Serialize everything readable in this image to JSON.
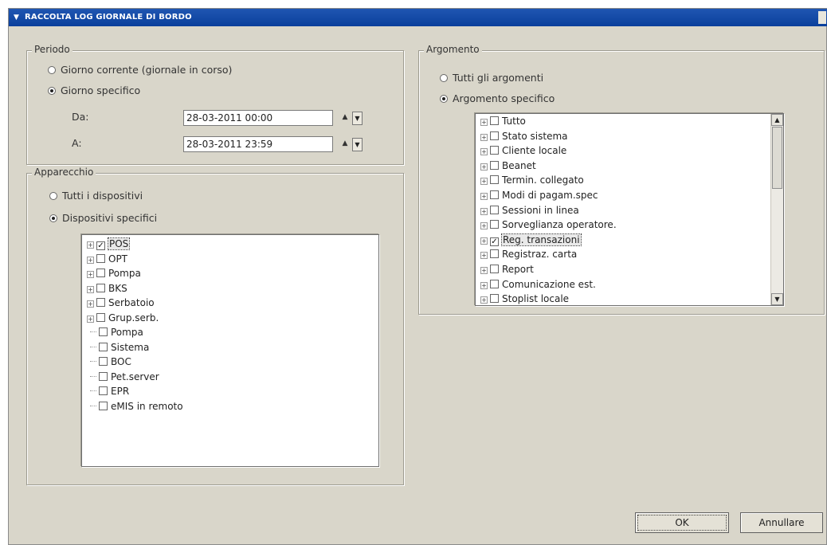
{
  "window": {
    "title": "RACCOLTA LOG GIORNALE DI BORDO"
  },
  "periodo": {
    "legend": "Periodo",
    "radio_current": "Giorno corrente (giornale in corso)",
    "radio_specific": "Giorno specifico",
    "da_label": "Da:",
    "da_value": "28-03-2011 00:00",
    "a_label": "A:",
    "a_value": "28-03-2011 23:59"
  },
  "apparecchio": {
    "legend": "Apparecchio",
    "radio_all": "Tutti i dispositivi",
    "radio_specific": "Dispositivi specifici",
    "devices": [
      {
        "label": "POS",
        "checked": true,
        "expandable": true
      },
      {
        "label": "OPT",
        "checked": false,
        "expandable": true
      },
      {
        "label": "Pompa",
        "checked": false,
        "expandable": true
      },
      {
        "label": "BKS",
        "checked": false,
        "expandable": true
      },
      {
        "label": "Serbatoio",
        "checked": false,
        "expandable": true
      },
      {
        "label": "Grup.serb.",
        "checked": false,
        "expandable": true
      },
      {
        "label": "Pompa",
        "checked": false,
        "expandable": false
      },
      {
        "label": "Sistema",
        "checked": false,
        "expandable": false
      },
      {
        "label": "BOC",
        "checked": false,
        "expandable": false
      },
      {
        "label": "Pet.server",
        "checked": false,
        "expandable": false
      },
      {
        "label": "EPR",
        "checked": false,
        "expandable": false
      },
      {
        "label": "eMIS in remoto",
        "checked": false,
        "expandable": false
      }
    ]
  },
  "argomento": {
    "legend": "Argomento",
    "radio_all": "Tutti gli argomenti",
    "radio_specific": "Argomento specifico",
    "topics": [
      {
        "label": "Tutto",
        "checked": false
      },
      {
        "label": "Stato sistema",
        "checked": false
      },
      {
        "label": "Cliente locale",
        "checked": false
      },
      {
        "label": "Beanet",
        "checked": false
      },
      {
        "label": "Termin.  collegato",
        "checked": false
      },
      {
        "label": "Modi di pagam.spec",
        "checked": false
      },
      {
        "label": "Sessioni in linea",
        "checked": false
      },
      {
        "label": "Sorveglianza operatore.",
        "checked": false
      },
      {
        "label": "Reg. transazioni",
        "checked": true
      },
      {
        "label": "Registraz. carta",
        "checked": false
      },
      {
        "label": "Report",
        "checked": false
      },
      {
        "label": "Comunicazione est.",
        "checked": false
      },
      {
        "label": "Stoplist locale",
        "checked": false
      }
    ]
  },
  "buttons": {
    "ok": "OK",
    "cancel": "Annullare"
  }
}
